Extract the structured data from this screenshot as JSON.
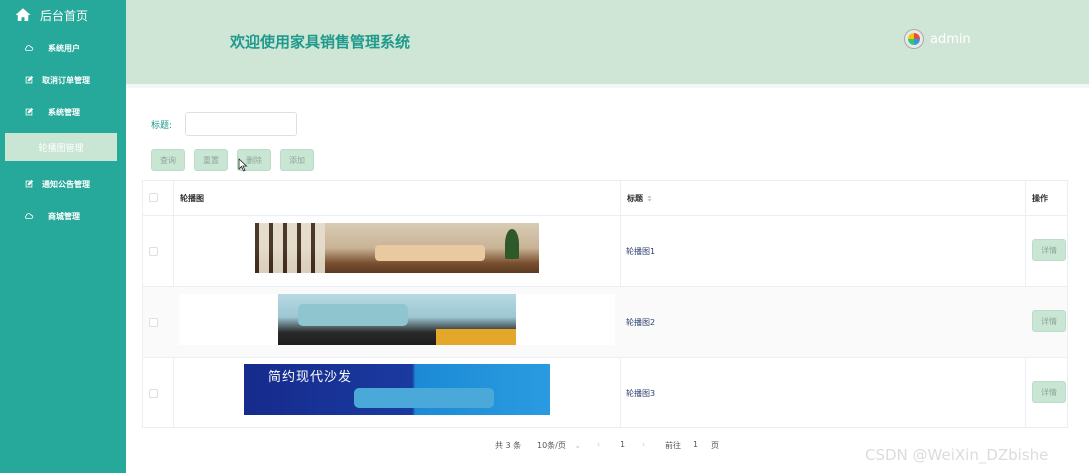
{
  "sidebar": {
    "home_label": "后台首页",
    "items": [
      {
        "label": "系统用户"
      },
      {
        "label": "取消订单管理"
      },
      {
        "label": "系统管理"
      },
      {
        "label": "轮播图管理"
      },
      {
        "label": "通知公告管理"
      },
      {
        "label": "商城管理"
      }
    ]
  },
  "header": {
    "title": "欢迎使用家具销售管理系统",
    "username": "admin"
  },
  "filter": {
    "label": "标题:",
    "placeholder": "",
    "value": ""
  },
  "toolbar": {
    "query": "查询",
    "reset": "重置",
    "delete": "删除",
    "add": "添加"
  },
  "table": {
    "headers": [
      "轮播图",
      "标题",
      "操作"
    ],
    "rows": [
      {
        "title": "轮播图1",
        "action": "详情"
      },
      {
        "title": "轮播图2",
        "action": "详情"
      },
      {
        "title": "轮播图3",
        "action": "详情"
      }
    ],
    "banner3_text": "简约现代沙发"
  },
  "pagination": {
    "total": "共 3 条",
    "page_size": "10条/页",
    "current": "1",
    "goto_label": "前往",
    "goto_value": "1",
    "page_unit": "页"
  },
  "watermark": "CSDN @WeiXin_DZbishe",
  "colors": {
    "sidebar": "#26a89a",
    "header": "#cfe6d6",
    "accent": "#1f9a8d",
    "button": "#c9e6d5"
  }
}
